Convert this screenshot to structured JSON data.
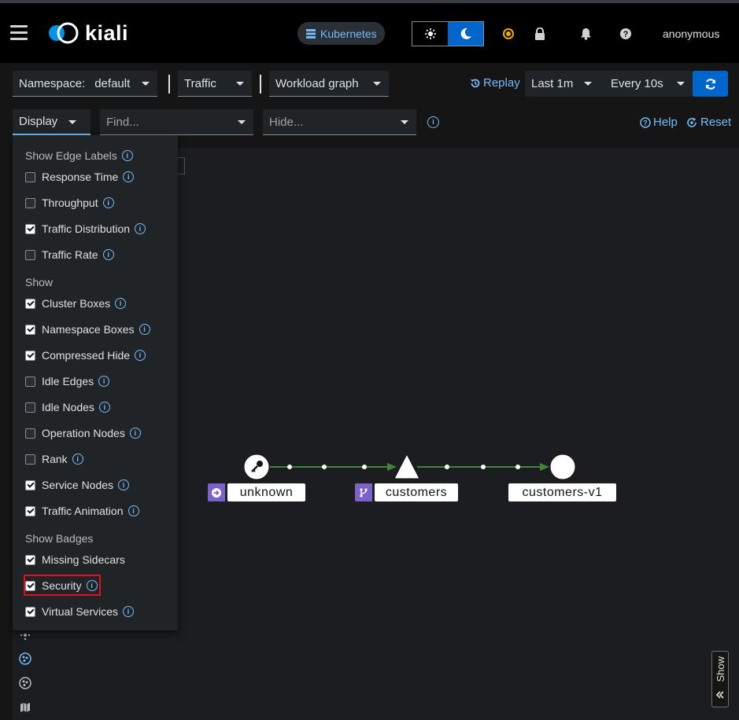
{
  "header": {
    "app_name": "kiali",
    "cluster_label": "Kubernetes",
    "username": "anonymous"
  },
  "toolbar": {
    "namespace_label": "Namespace:",
    "namespace_value": "default",
    "traffic_label": "Traffic",
    "graph_type": "Workload graph",
    "replay_label": "Replay",
    "duration": "Last 1m",
    "refresh_interval": "Every 10s",
    "display_label": "Display",
    "find_placeholder": "Find...",
    "hide_placeholder": "Hide...",
    "help_label": "Help",
    "reset_label": "Reset"
  },
  "display_menu": {
    "edge_labels_header": "Show Edge Labels",
    "edge_labels": [
      {
        "label": "Response Time",
        "checked": false
      },
      {
        "label": "Throughput",
        "checked": false
      },
      {
        "label": "Traffic Distribution",
        "checked": true
      },
      {
        "label": "Traffic Rate",
        "checked": false
      }
    ],
    "show_header": "Show",
    "show_items": [
      {
        "label": "Cluster Boxes",
        "checked": true
      },
      {
        "label": "Namespace Boxes",
        "checked": true
      },
      {
        "label": "Compressed Hide",
        "checked": true
      },
      {
        "label": "Idle Edges",
        "checked": false
      },
      {
        "label": "Idle Nodes",
        "checked": false
      },
      {
        "label": "Operation Nodes",
        "checked": false
      },
      {
        "label": "Rank",
        "checked": false
      },
      {
        "label": "Service Nodes",
        "checked": true
      },
      {
        "label": "Traffic Animation",
        "checked": true
      }
    ],
    "badges_header": "Show Badges",
    "badge_items": [
      {
        "label": "Missing Sidecars",
        "checked": true
      },
      {
        "label": "Security",
        "checked": true
      },
      {
        "label": "Virtual Services",
        "checked": true
      }
    ]
  },
  "graph": {
    "nodes": [
      "unknown",
      "customers",
      "customers-v1"
    ]
  },
  "side_panel": {
    "show_label": "Show"
  },
  "colors": {
    "accent": "#0066cc",
    "link": "#73bcf7",
    "edge": "#3e8635",
    "highlight": "#e0101c"
  }
}
